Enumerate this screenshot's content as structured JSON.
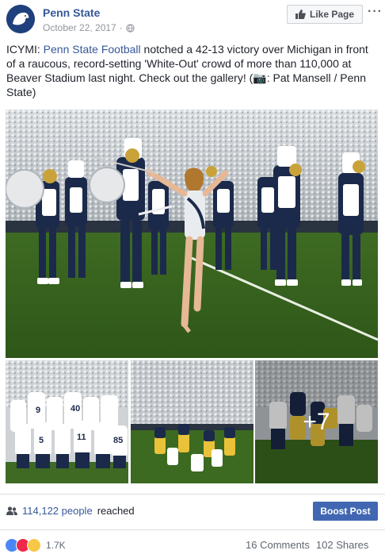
{
  "header": {
    "page_name": "Penn State",
    "date": "October 22, 2017",
    "date_separator": "·",
    "like_page_label": "Like Page",
    "more_label": "···"
  },
  "post": {
    "text_prefix": "ICYMI: ",
    "text_link": "Penn State Football",
    "text_body": " notched a 42-13 victory over Michigan in front of a raucous, record-setting 'White-Out' crowd of more than 110,000 at Beaver Stadium last night. Check out the gallery! (📷: Pat Mansell / Penn State)"
  },
  "gallery": {
    "more_count": "+7"
  },
  "insights": {
    "reach_count": "114,122 people",
    "reach_suffix": "reached",
    "boost_label": "Boost Post"
  },
  "engagement": {
    "reaction_count": "1.7K",
    "comments": "16 Comments",
    "shares": "102 Shares"
  },
  "colors": {
    "link": "#365899",
    "boost": "#4267b2",
    "brand_navy": "#1e407c"
  }
}
